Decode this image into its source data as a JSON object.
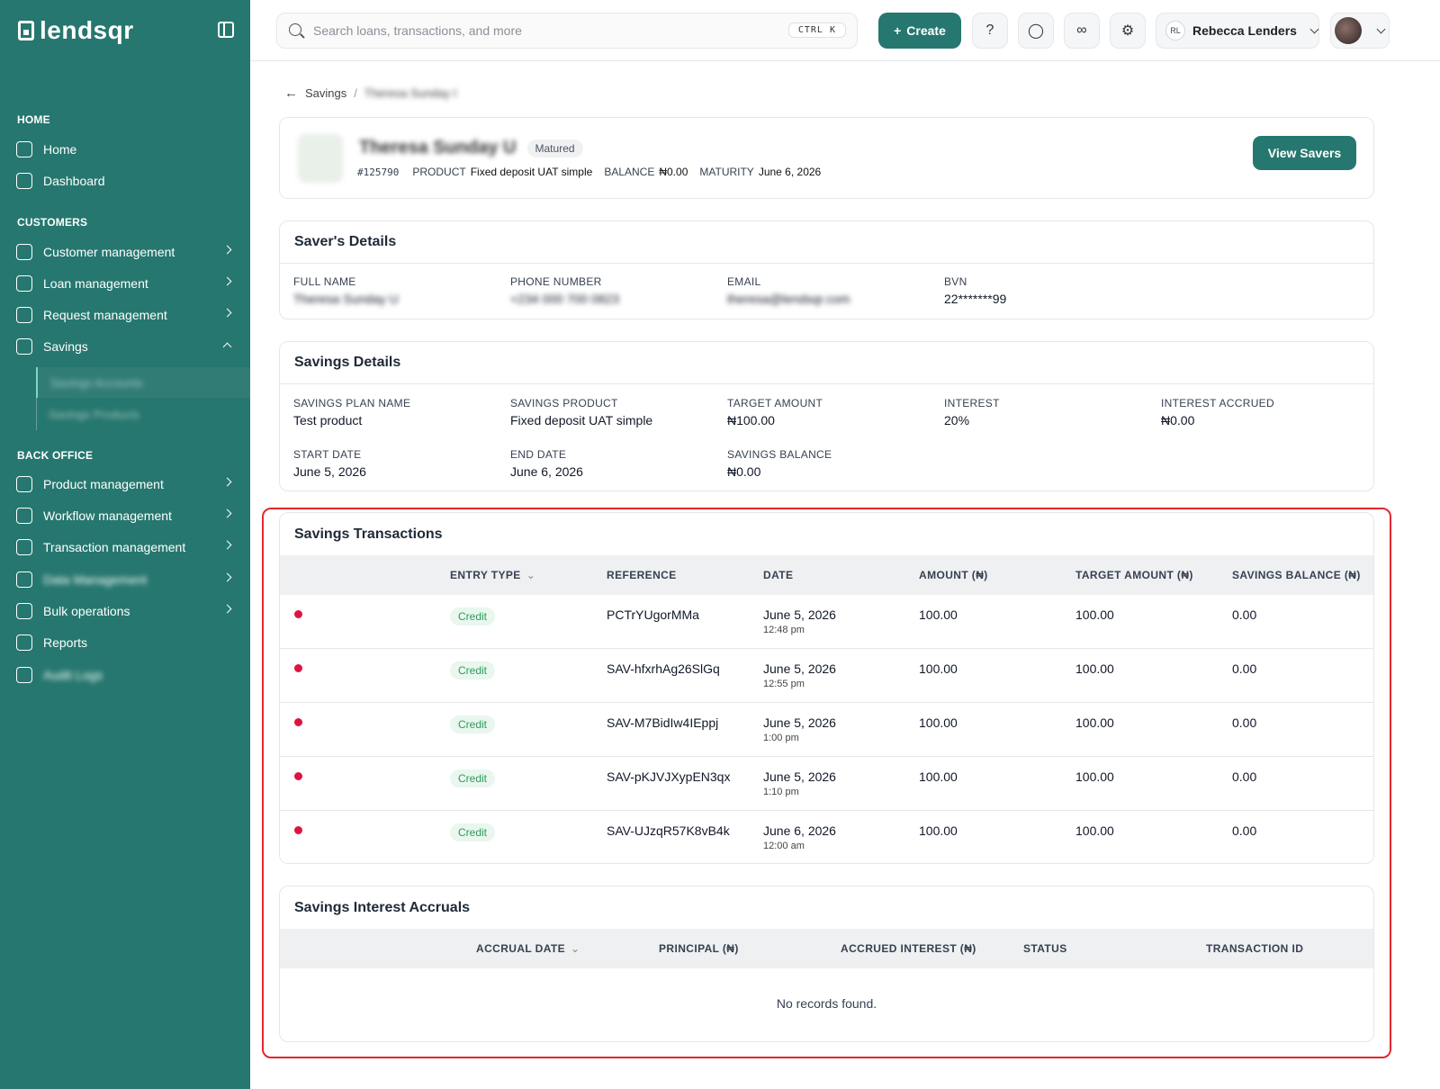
{
  "sidebar": {
    "logo": "lendsqr",
    "sections": {
      "home": "HOME",
      "customers": "CUSTOMERS",
      "back_office": "BACK OFFICE"
    },
    "items": {
      "home": "Home",
      "dashboard": "Dashboard",
      "customer_management": "Customer management",
      "loan_management": "Loan management",
      "request_management": "Request management",
      "savings": "Savings",
      "savings_accounts": "Savings Accounts",
      "savings_products": "Savings Products",
      "product_management": "Product management",
      "workflow_management": "Workflow management",
      "transaction_management": "Transaction management",
      "data_management": "Data Management",
      "bulk_operations": "Bulk operations",
      "reports": "Reports",
      "audit_logs": "Audit Logs"
    }
  },
  "header": {
    "search_placeholder": "Search loans, transactions, and more",
    "shortcut": "CTRL K",
    "create_label": "Create",
    "user_initials": "RL",
    "user_name": "Rebecca Lenders"
  },
  "breadcrumb": {
    "parent": "Savings",
    "separator": "/",
    "current": "Theresa Sunday I"
  },
  "summary": {
    "name": "Theresa Sunday U",
    "status": "Matured",
    "id": "#125790",
    "product_label": "PRODUCT",
    "product": "Fixed deposit UAT simple",
    "balance_label": "BALANCE",
    "balance": "₦0.00",
    "maturity_label": "MATURITY",
    "maturity": "June 6, 2026",
    "view_button": "View Savers"
  },
  "saver_details": {
    "title": "Saver's Details",
    "fields": [
      {
        "label": "FULL NAME",
        "value": "Theresa Sunday U",
        "blurred": true
      },
      {
        "label": "PHONE NUMBER",
        "value": "+234 000 700 0823",
        "blurred": true
      },
      {
        "label": "EMAIL",
        "value": "theresa@lendsqr.com",
        "blurred": true
      },
      {
        "label": "BVN",
        "value": "22*******99",
        "blurred": false
      }
    ]
  },
  "savings_details": {
    "title": "Savings Details",
    "fields": [
      {
        "label": "SAVINGS PLAN NAME",
        "value": "Test product"
      },
      {
        "label": "SAVINGS PRODUCT",
        "value": "Fixed deposit UAT simple"
      },
      {
        "label": "TARGET AMOUNT",
        "value": "₦100.00"
      },
      {
        "label": "INTEREST",
        "value": "20%"
      },
      {
        "label": "INTEREST ACCRUED",
        "value": "₦0.00"
      },
      {
        "label": "START DATE",
        "value": "June 5, 2026"
      },
      {
        "label": "END DATE",
        "value": "June 6, 2026"
      },
      {
        "label": "SAVINGS BALANCE",
        "value": "₦0.00"
      }
    ]
  },
  "transactions": {
    "title": "Savings Transactions",
    "columns": [
      "ENTRY TYPE",
      "REFERENCE",
      "DATE",
      "AMOUNT (₦)",
      "TARGET AMOUNT (₦)",
      "SAVINGS BALANCE (₦)"
    ],
    "rows": [
      {
        "entry_type": "Credit",
        "reference": "PCTrYUgorMMa",
        "date": "June 5, 2026",
        "time": "12:48 pm",
        "amount": "100.00",
        "target_amount": "100.00",
        "savings_balance": "0.00"
      },
      {
        "entry_type": "Credit",
        "reference": "SAV-hfxrhAg26SlGq",
        "date": "June 5, 2026",
        "time": "12:55 pm",
        "amount": "100.00",
        "target_amount": "100.00",
        "savings_balance": "0.00"
      },
      {
        "entry_type": "Credit",
        "reference": "SAV-M7BidIw4IEppj",
        "date": "June 5, 2026",
        "time": "1:00 pm",
        "amount": "100.00",
        "target_amount": "100.00",
        "savings_balance": "0.00"
      },
      {
        "entry_type": "Credit",
        "reference": "SAV-pKJVJXypEN3qx",
        "date": "June 5, 2026",
        "time": "1:10 pm",
        "amount": "100.00",
        "target_amount": "100.00",
        "savings_balance": "0.00"
      },
      {
        "entry_type": "Credit",
        "reference": "SAV-UJzqR57K8vB4k",
        "date": "June 6, 2026",
        "time": "12:00 am",
        "amount": "100.00",
        "target_amount": "100.00",
        "savings_balance": "0.00"
      }
    ]
  },
  "accruals": {
    "title": "Savings Interest Accruals",
    "columns": [
      "ACCRUAL DATE",
      "PRINCIPAL (₦)",
      "ACCRUED INTEREST (₦)",
      "STATUS",
      "TRANSACTION ID"
    ],
    "empty_message": "No records found."
  },
  "colors": {
    "brand": "#26776f",
    "highlight": "#e0282e",
    "credit_badge": "#2e9a5c",
    "status_dot": "#e0123f"
  }
}
